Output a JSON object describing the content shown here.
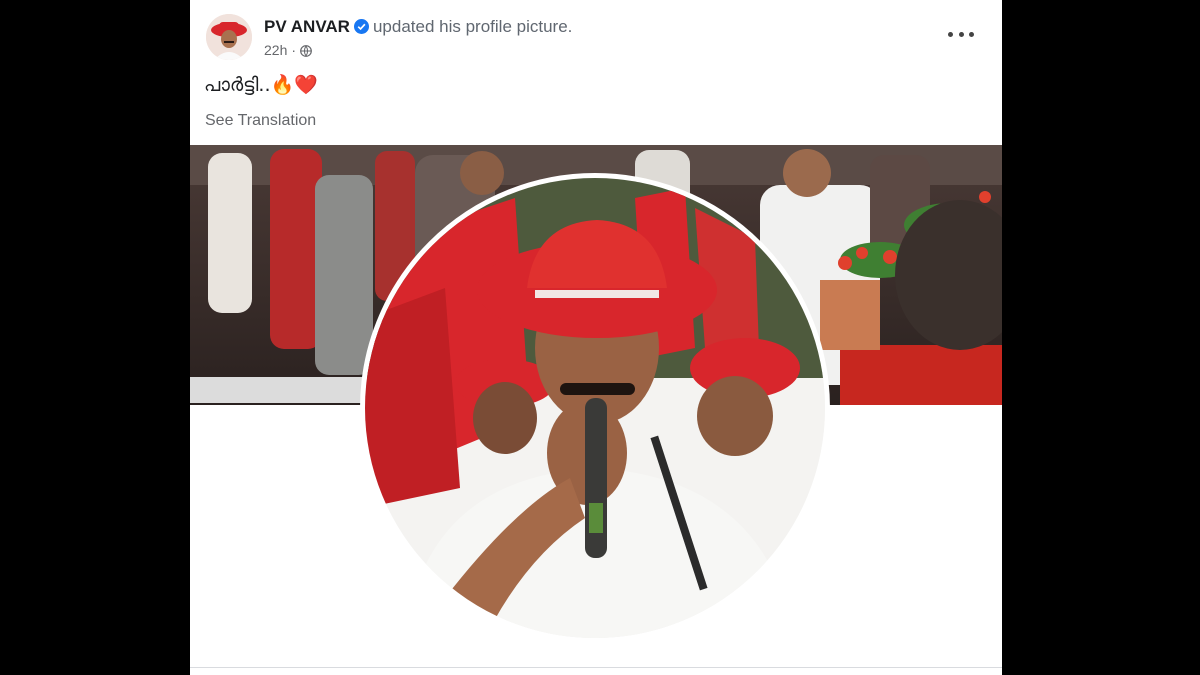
{
  "post": {
    "author_name": "PV ANVAR",
    "action_text": "updated his profile picture.",
    "timestamp": "22h",
    "separator": "·",
    "caption_text": "പാർട്ടി..",
    "caption_emoji": "🔥❤️",
    "see_translation": "See Translation",
    "verified": true
  },
  "colors": {
    "verified_blue": "#1877f2",
    "hat_red": "#d8262c",
    "shirt_white": "#f7f7f5",
    "crowd_dark": "#3b2b28"
  },
  "icons": [
    "verified-badge-icon",
    "globe-icon",
    "more-options-icon"
  ]
}
